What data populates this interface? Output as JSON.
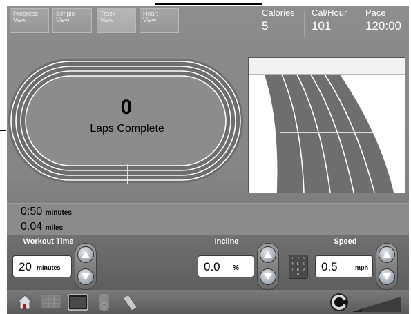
{
  "tabs": [
    {
      "label": "Progress\nView",
      "active": false
    },
    {
      "label": "Simple\nView",
      "active": false
    },
    {
      "label": "Track\nView",
      "active": true
    },
    {
      "label": "Heart\nView",
      "active": false
    }
  ],
  "stats": {
    "calories": {
      "label": "Calories",
      "value": "5"
    },
    "cal_hour": {
      "label": "Cal/Hour",
      "value": "101"
    },
    "pace": {
      "label": "Pace",
      "value": "120:00"
    }
  },
  "track": {
    "laps": "0",
    "laps_label": "Laps Complete"
  },
  "progress": {
    "time_value": "0:50",
    "time_unit": "minutes",
    "distance_value": "0.04",
    "distance_unit": "miles"
  },
  "controls": {
    "workout_time": {
      "title": "Workout Time",
      "value": "20",
      "unit": "minutes"
    },
    "incline": {
      "title": "Incline",
      "value": "0.0",
      "unit": "%"
    },
    "speed": {
      "title": "Speed",
      "value": "0.5",
      "unit": "mph"
    }
  },
  "keypad_digits": [
    "1",
    "2",
    "3",
    "4",
    "5",
    "6",
    "7",
    "8",
    "9",
    "0"
  ],
  "icons": {
    "home": "home-icon",
    "grid": "grid-icon",
    "screen": "tv-icon",
    "ipod": "media-player-icon",
    "remote": "remote-icon",
    "volume": "volume-icon"
  },
  "colors": {
    "lane": "#6e6e6e",
    "lane_line": "#ffffff",
    "panel": "#8a8a8a"
  }
}
